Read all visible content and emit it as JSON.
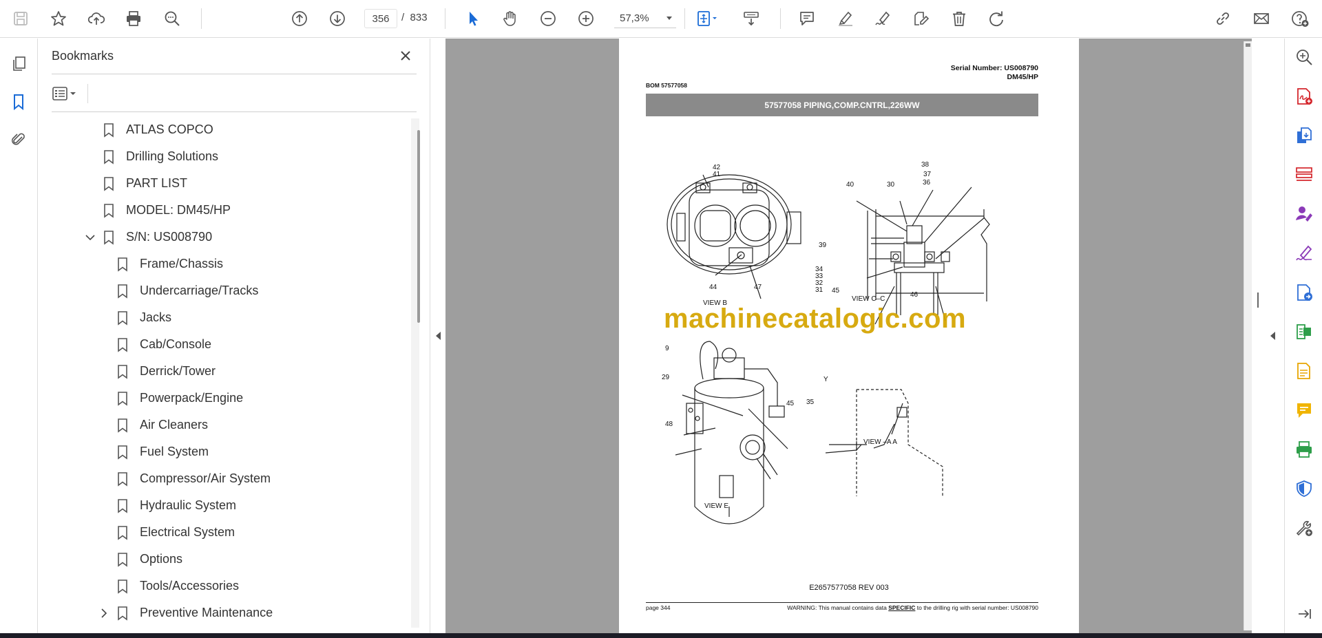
{
  "toolbar": {
    "icons": [
      "save-icon",
      "star-icon",
      "upload-icon",
      "print-icon",
      "find-icon",
      "prev-page-icon",
      "next-page-icon",
      "zoom-out-icon",
      "zoom-in-icon",
      "select-icon",
      "hand-icon",
      "fit-icon",
      "scroll-mode-icon",
      "comment-icon",
      "highlight-icon",
      "sign-icon",
      "edit-icon",
      "delete-icon",
      "rotate-icon",
      "share-link-icon",
      "mail-icon",
      "help-icon"
    ],
    "current_page": "356",
    "page_sep": "/",
    "total_pages": "833",
    "zoom": "57,3%"
  },
  "bookmarks": {
    "title": "Bookmarks",
    "items": [
      {
        "label": "ATLAS COPCO",
        "level": 0,
        "toggle": ""
      },
      {
        "label": "Drilling Solutions",
        "level": 0,
        "toggle": ""
      },
      {
        "label": "PART LIST",
        "level": 0,
        "toggle": ""
      },
      {
        "label": "MODEL: DM45/HP",
        "level": 0,
        "toggle": ""
      },
      {
        "label": "S/N: US008790",
        "level": 0,
        "toggle": "expanded"
      },
      {
        "label": "Frame/Chassis",
        "level": 1,
        "toggle": ""
      },
      {
        "label": "Undercarriage/Tracks",
        "level": 1,
        "toggle": ""
      },
      {
        "label": "Jacks",
        "level": 1,
        "toggle": ""
      },
      {
        "label": "Cab/Console",
        "level": 1,
        "toggle": ""
      },
      {
        "label": "Derrick/Tower",
        "level": 1,
        "toggle": ""
      },
      {
        "label": "Powerpack/Engine",
        "level": 1,
        "toggle": ""
      },
      {
        "label": "Air Cleaners",
        "level": 1,
        "toggle": ""
      },
      {
        "label": "Fuel System",
        "level": 1,
        "toggle": ""
      },
      {
        "label": "Compressor/Air System",
        "level": 1,
        "toggle": ""
      },
      {
        "label": "Hydraulic System",
        "level": 1,
        "toggle": ""
      },
      {
        "label": "Electrical System",
        "level": 1,
        "toggle": ""
      },
      {
        "label": "Options",
        "level": 1,
        "toggle": ""
      },
      {
        "label": "Tools/Accessories",
        "level": 1,
        "toggle": ""
      },
      {
        "label": "Preventive Maintenance",
        "level": 1,
        "toggle": "collapsed"
      }
    ]
  },
  "document": {
    "serial_line1": "Serial Number: US008790",
    "serial_line2": "DM45/HP",
    "bom": "BOM 57577058",
    "banner": "57577058 PIPING,COMP.CNTRL,226WW",
    "watermark": "machinecatalogic.com",
    "drawing_ref": "E2657577058 REV 003",
    "footer_page": "page 344",
    "footer_warning_pre": "WARNING:  This manual contains data ",
    "footer_warning_em": "SPECIFIC",
    "footer_warning_post": " to the drilling rig with serial number: US008790",
    "views": {
      "b": "VIEW B",
      "cc": "VIEW C–C",
      "e": "VIEW E",
      "aa": "VIEW –A A",
      "y": "Y"
    },
    "callouts": [
      "42",
      "41",
      "44",
      "47",
      "40",
      "30",
      "38",
      "37",
      "36",
      "39",
      "34",
      "33",
      "32",
      "31",
      "45",
      "46",
      "9",
      "29",
      "48",
      "45",
      "35"
    ]
  },
  "right_tools": [
    "zoom-tool-icon",
    "create-pdf-icon",
    "export-pdf-icon",
    "organize-pages-icon",
    "request-signature-icon",
    "fill-sign-icon",
    "edit-pdf-icon",
    "compress-icon",
    "export-icon",
    "comment-tool-icon",
    "print-production-icon",
    "protect-icon",
    "more-tools-icon",
    "expand-icon"
  ]
}
